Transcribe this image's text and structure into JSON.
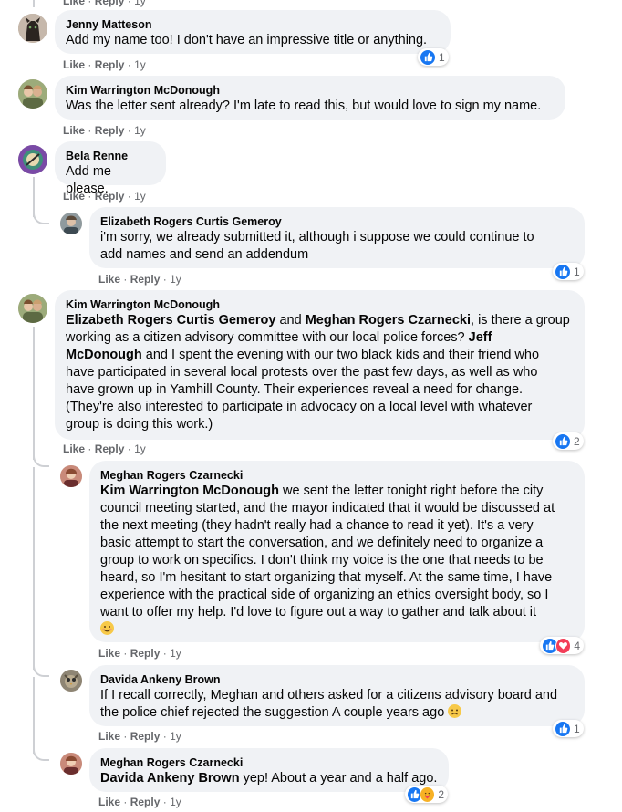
{
  "ui": {
    "like": "Like",
    "reply": "Reply",
    "sep": "·"
  },
  "top_cut": {
    "like": "Like",
    "reply": "Reply",
    "time": "1y"
  },
  "comments": [
    {
      "author": "Jenny Matteson",
      "text": "Add my name too! I don't have an impressive title or anything.",
      "time": "1y",
      "reactions": {
        "count": "1",
        "types": [
          "like"
        ]
      }
    },
    {
      "author": "Kim Warrington McDonough",
      "text": "Was the letter sent already? I'm late to read this, but would love to sign my name.",
      "time": "1y"
    },
    {
      "author": "Bela Renne",
      "text": "Add me please.",
      "time": "1y"
    },
    {
      "author": "Elizabeth Rogers Curtis Gemeroy",
      "line1": "i'm sorry, we already submitted it, although i suppose we could continue to",
      "line2": "add names and send an addendum",
      "time": "1y",
      "reactions": {
        "count": "1",
        "types": [
          "like"
        ]
      }
    },
    {
      "author": "Kim Warrington McDonough",
      "mention1": "Elizabeth Rogers Curtis Gemeroy",
      "and": " and ",
      "mention2": "Meghan Rogers Czarnecki",
      "after_mentions": ", is there a group",
      "line2": "working as a citizen advisory committee with our local police forces? ",
      "mention3": "Jeff",
      "mention3b": "McDonough",
      "line3": " and I spent the evening with our two black kids and their friend who",
      "line4": "have participated in several local protests over the past few days, as well as who",
      "line5": "have grown up in Yamhill County. Their experiences reveal a need for change.",
      "line6": "(They're also interested to participate in advocacy on a local level with whatever",
      "line7": "group is doing this work.)",
      "time": "1y",
      "reactions": {
        "count": "2",
        "types": [
          "like"
        ]
      }
    },
    {
      "author": "Meghan Rogers Czarnecki",
      "mention": "Kim Warrington McDonough",
      "line1": " we sent the letter tonight right before the city",
      "line2": "council meeting started, and the mayor indicated that it would be discussed at",
      "line3": "the next meeting (they hadn't really had a chance to read it yet). It's a very",
      "line4": "basic attempt to start the conversation, and we definitely need to organize a",
      "line5": "group to work on specifics. I don't think my voice is the one that needs to be",
      "line6": "heard, so I'm hesitant to start organizing that myself. At the same time, I have",
      "line7": "experience with the practical side of organizing an ethics oversight body, so I",
      "line8": "want to offer my help. I'd love to figure out a way to gather and talk about it",
      "time": "1y",
      "reactions": {
        "count": "4",
        "types": [
          "like",
          "love"
        ]
      }
    },
    {
      "author": "Davida Ankeny Brown",
      "line1": "If I recall correctly, Meghan and others asked for a citizens advisory board and",
      "line2": "the police chief rejected the suggestion A couple years ago ",
      "time": "1y",
      "reactions": {
        "count": "1",
        "types": [
          "like"
        ]
      }
    },
    {
      "author": "Meghan Rogers Czarnecki",
      "mention": "Davida Ankeny Brown",
      "text": " yep! About a year and a half ago.",
      "time": "1y",
      "reactions": {
        "count": "2",
        "types": [
          "like",
          "care"
        ]
      }
    }
  ]
}
